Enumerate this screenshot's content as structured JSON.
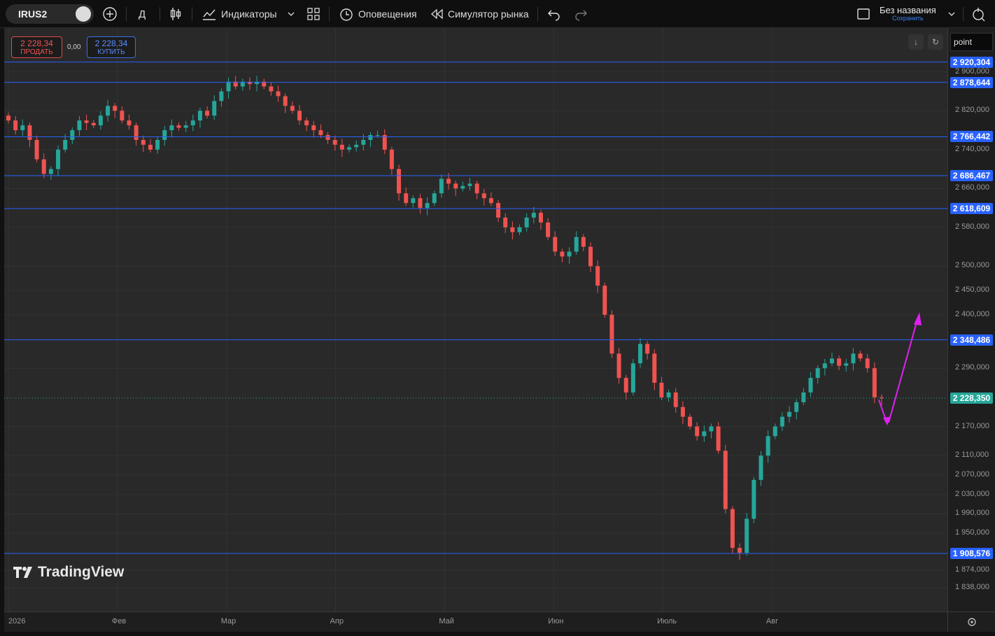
{
  "toolbar": {
    "symbol": "IRUS2",
    "interval": "Д",
    "indicators_label": "Индикаторы",
    "alerts_label": "Оповещения",
    "replay_label": "Симулятор рынка",
    "layout_title": "Без названия",
    "layout_save": "Сохранить"
  },
  "trade": {
    "sell_price": "2 228,34",
    "sell_label": "ПРОДАТЬ",
    "spread": "0,00",
    "buy_price": "2 228,34",
    "buy_label": "КУПИТЬ"
  },
  "price_axis": {
    "scale_label": "point",
    "ticks": [
      {
        "label": "2 900,000",
        "v": 2900
      },
      {
        "label": "2 820,000",
        "v": 2820
      },
      {
        "label": "2 740,000",
        "v": 2740
      },
      {
        "label": "2 660,000",
        "v": 2660
      },
      {
        "label": "2 580,000",
        "v": 2580
      },
      {
        "label": "2 500,000",
        "v": 2500
      },
      {
        "label": "2 450,000",
        "v": 2450
      },
      {
        "label": "2 400,000",
        "v": 2400
      },
      {
        "label": "2 290,000",
        "v": 2290
      },
      {
        "label": "2 170,000",
        "v": 2170
      },
      {
        "label": "2 110,000",
        "v": 2110
      },
      {
        "label": "2 070,000",
        "v": 2070
      },
      {
        "label": "2 030,000",
        "v": 2030
      },
      {
        "label": "1 990,000",
        "v": 1990
      },
      {
        "label": "1 950,000",
        "v": 1950
      },
      {
        "label": "1 874,000",
        "v": 1874
      },
      {
        "label": "1 838,000",
        "v": 1838
      }
    ],
    "levels": [
      {
        "label": "2 920,304",
        "v": 2920.304
      },
      {
        "label": "2 878,644",
        "v": 2878.644
      },
      {
        "label": "2 766,442",
        "v": 2766.442
      },
      {
        "label": "2 686,467",
        "v": 2686.467
      },
      {
        "label": "2 618,609",
        "v": 2618.609
      },
      {
        "label": "2 348,486",
        "v": 2348.486
      },
      {
        "label": "1 908,576",
        "v": 1908.576
      }
    ],
    "current": {
      "label": "2 228,350",
      "v": 2228.35
    }
  },
  "time_axis": [
    "2026",
    "Фев",
    "Мар",
    "Апр",
    "Май",
    "Июн",
    "Июль",
    "Авг"
  ],
  "branding": {
    "logo_text": "TradingView"
  },
  "colors": {
    "up": "#26a69a",
    "down": "#ef5350",
    "level": "#2962ff",
    "arrow": "#e020f0",
    "current": "#26a69a"
  },
  "chart_data": {
    "type": "candlestick",
    "x_months": [
      "2026",
      "Фев",
      "Мар",
      "Апр",
      "Май",
      "Июн",
      "Июль",
      "Авг"
    ],
    "ylim": [
      1838,
      2940
    ],
    "close_series": [
      2800,
      2780,
      2790,
      2760,
      2720,
      2690,
      2700,
      2740,
      2760,
      2780,
      2800,
      2795,
      2790,
      2810,
      2830,
      2820,
      2800,
      2790,
      2760,
      2750,
      2740,
      2760,
      2780,
      2790,
      2785,
      2790,
      2800,
      2820,
      2810,
      2840,
      2860,
      2880,
      2870,
      2880,
      2875,
      2880,
      2870,
      2860,
      2850,
      2830,
      2820,
      2800,
      2790,
      2780,
      2770,
      2760,
      2750,
      2740,
      2745,
      2750,
      2760,
      2770,
      2770,
      2740,
      2700,
      2650,
      2630,
      2640,
      2620,
      2630,
      2650,
      2680,
      2670,
      2660,
      2665,
      2670,
      2650,
      2640,
      2630,
      2600,
      2580,
      2570,
      2580,
      2600,
      2610,
      2590,
      2560,
      2530,
      2520,
      2530,
      2560,
      2540,
      2500,
      2460,
      2400,
      2320,
      2270,
      2240,
      2300,
      2340,
      2320,
      2260,
      2230,
      2240,
      2210,
      2190,
      2170,
      2150,
      2160,
      2170,
      2120,
      2000,
      1920,
      1910,
      1980,
      2060,
      2110,
      2150,
      2170,
      2190,
      2200,
      2220,
      2240,
      2270,
      2290,
      2300,
      2310,
      2295,
      2300,
      2320,
      2310,
      2290,
      2230,
      2228
    ]
  }
}
